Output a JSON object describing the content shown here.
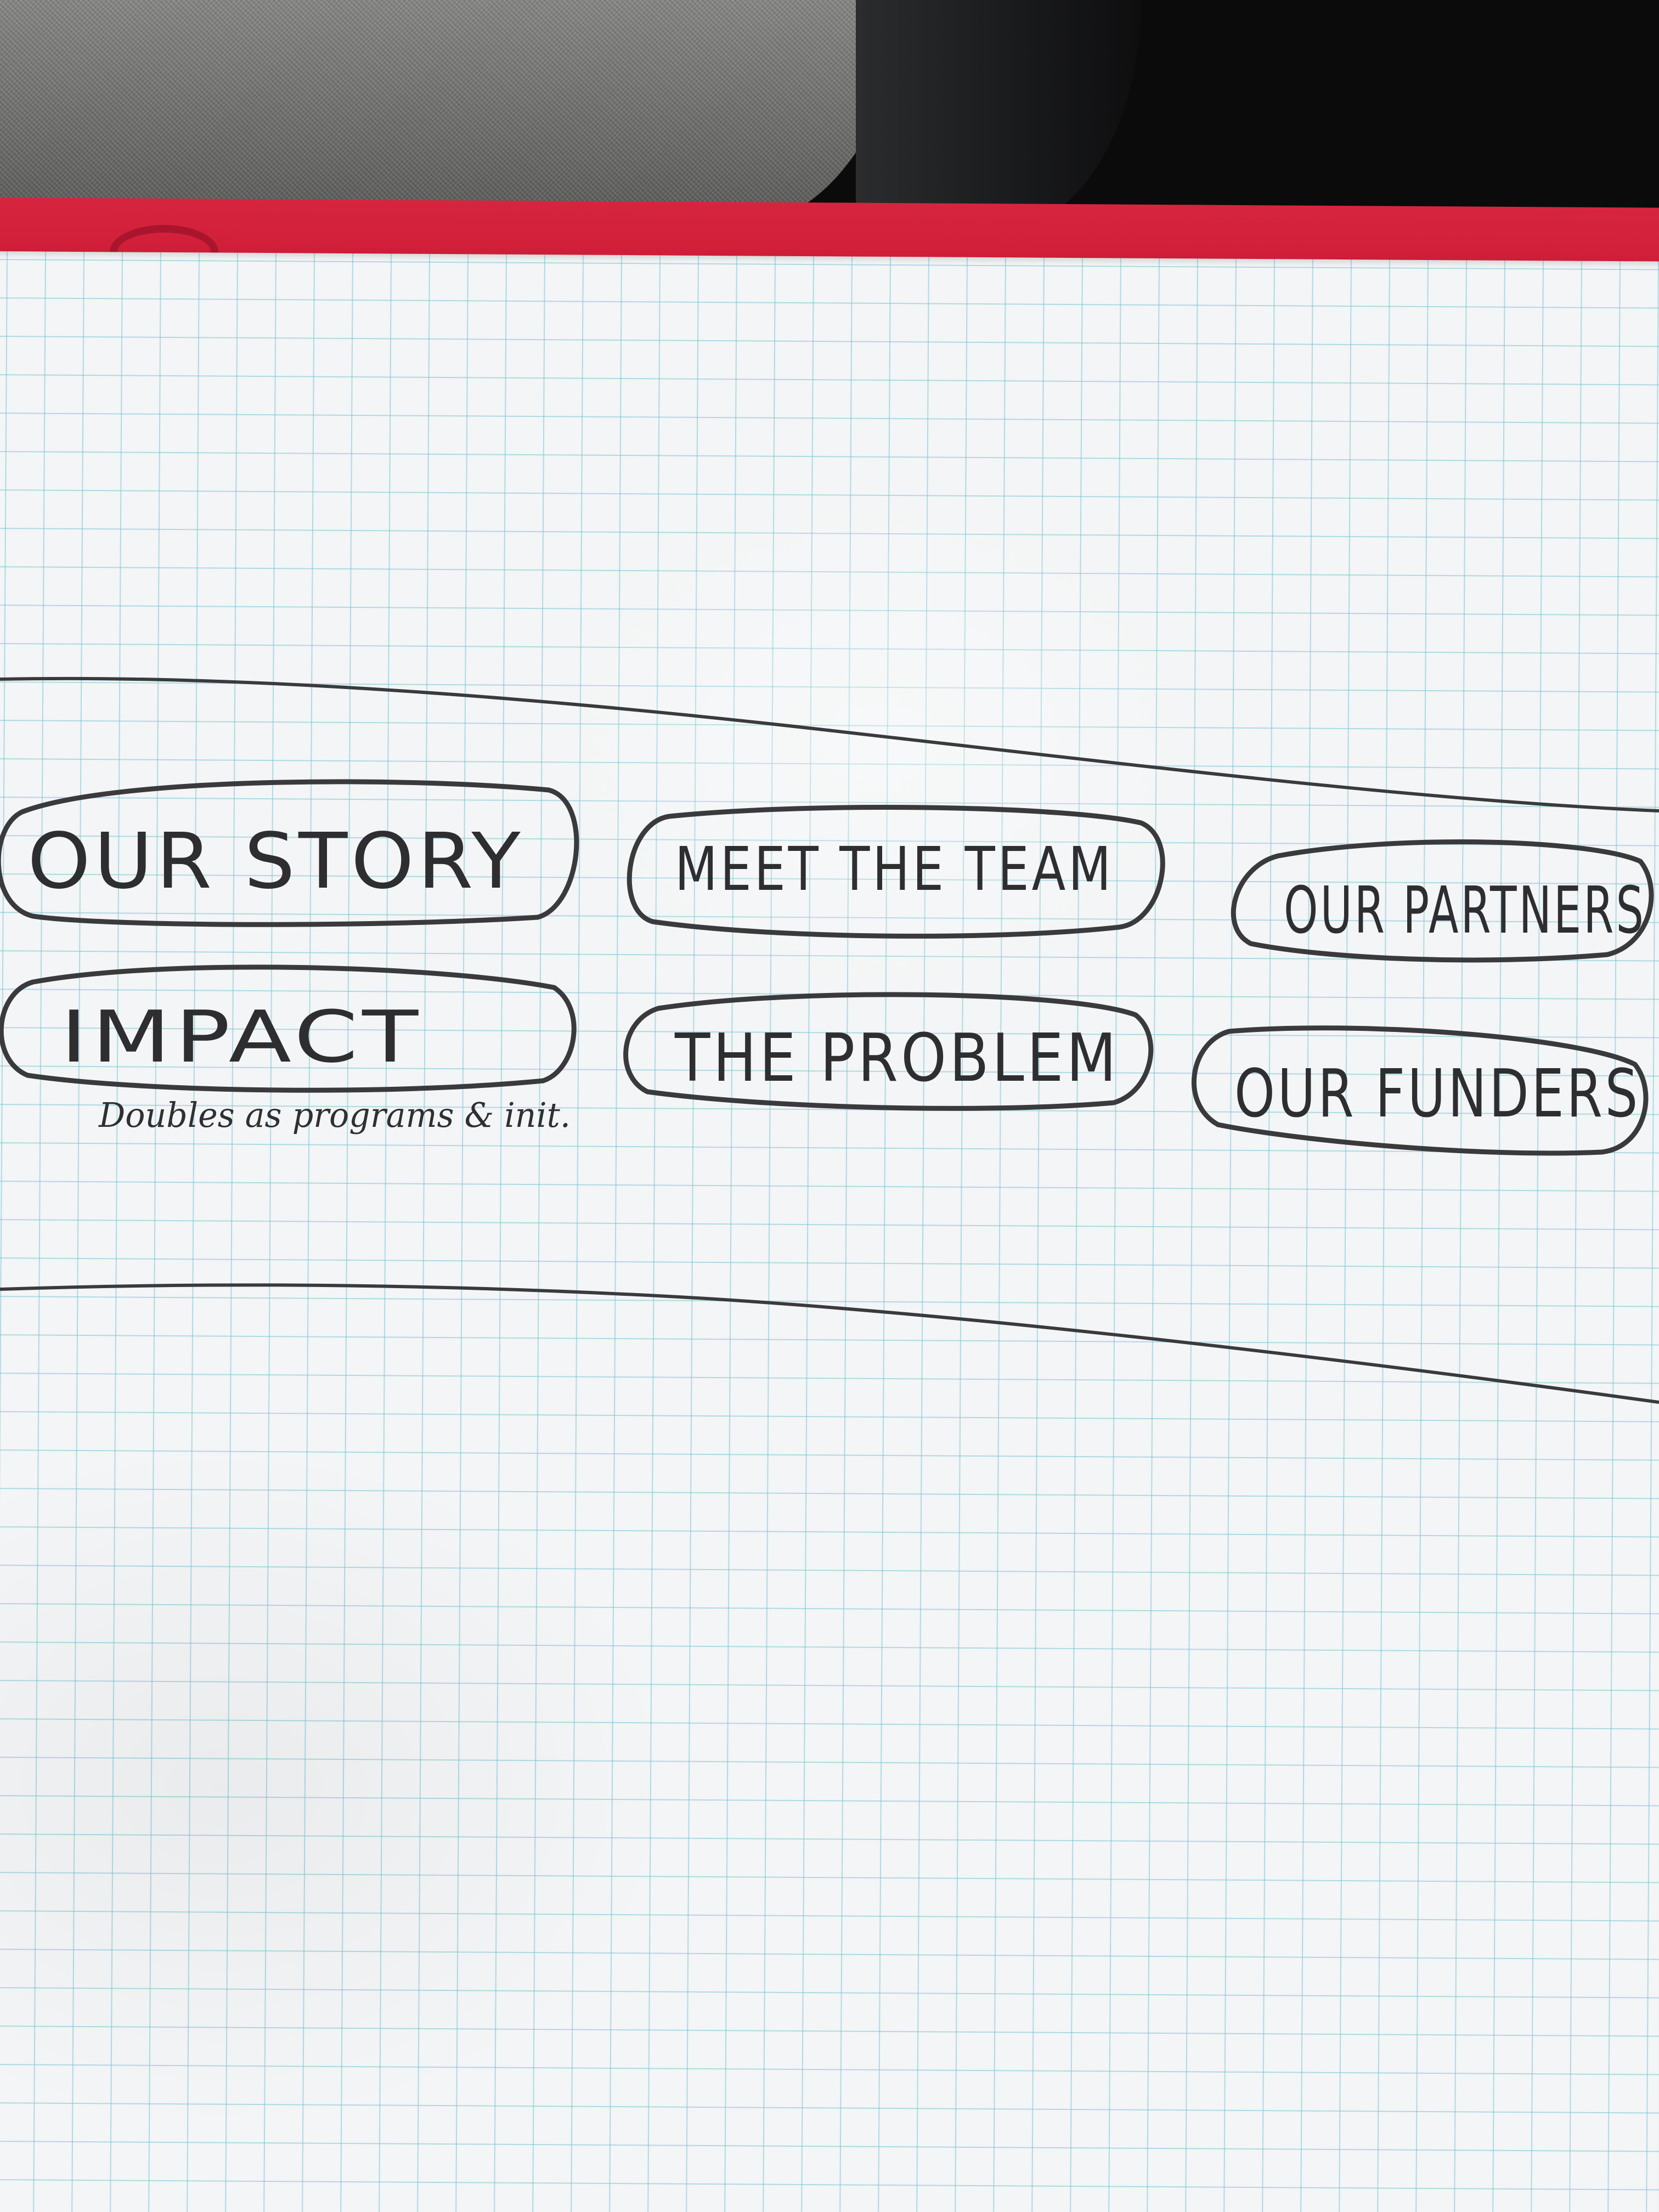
{
  "sketch": {
    "nav_items": [
      "OUR STORY",
      "MEET THE TEAM",
      "OUR PARTNERS",
      "IMPACT",
      "THE PROBLEM",
      "OUR FUNDERS"
    ],
    "annotation": "Doubles as programs & init."
  },
  "colors": {
    "paper": "#f3f5f6",
    "grid": "#78c3d2",
    "ink": "#2e2e30",
    "cover": "#d21f3a",
    "fabric": "#6f6f6e"
  }
}
